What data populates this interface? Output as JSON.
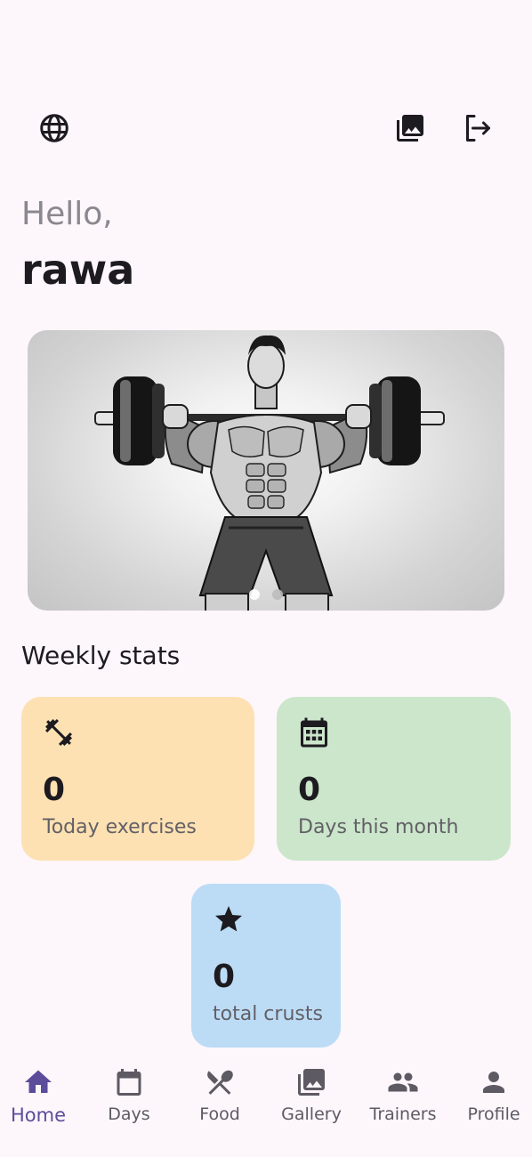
{
  "header": {
    "greeting": "Hello,",
    "username": "rawa",
    "icons": [
      "language-icon",
      "gallery-icon",
      "logout-icon"
    ]
  },
  "hero": {
    "slide_count": 2,
    "active_slide": 1
  },
  "stats": {
    "title": "Weekly stats",
    "cards": [
      {
        "icon": "dumbbell-icon",
        "value": "0",
        "label": "Today exercises",
        "color": "#fde1b2"
      },
      {
        "icon": "calendar-icon",
        "value": "0",
        "label": "Days this month",
        "color": "#cbe6cb"
      },
      {
        "icon": "star-icon",
        "value": "0",
        "label": "total crusts",
        "color": "#bcdcf6"
      }
    ]
  },
  "nav": {
    "active": "Home",
    "active_color": "#5c4d9a",
    "items": [
      {
        "label": "Home",
        "icon": "home-icon"
      },
      {
        "label": "Days",
        "icon": "calendar-icon"
      },
      {
        "label": "Food",
        "icon": "food-icon"
      },
      {
        "label": "Gallery",
        "icon": "gallery-icon"
      },
      {
        "label": "Trainers",
        "icon": "people-icon"
      },
      {
        "label": "Profile",
        "icon": "person-icon"
      }
    ]
  }
}
